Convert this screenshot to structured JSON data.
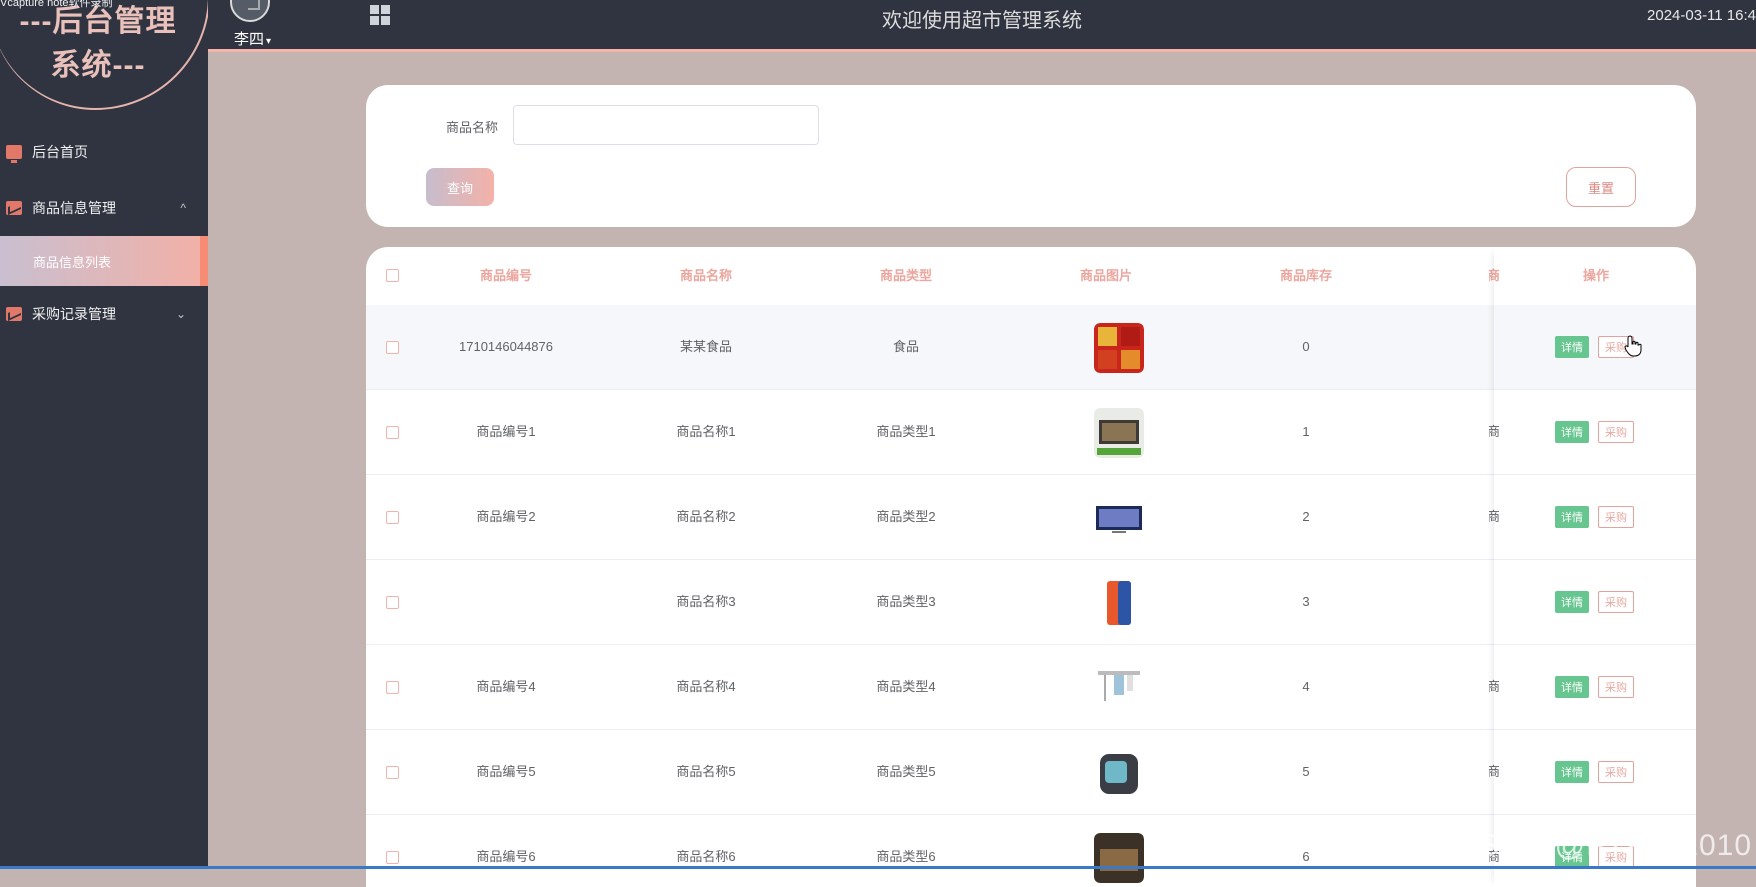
{
  "watermark_top": "Vcapture note软件录制",
  "logo": {
    "line1": "---后台管理",
    "line2": "系统---"
  },
  "sidebar": {
    "items": [
      {
        "label": "后台首页",
        "icon": "monitor-icon"
      },
      {
        "label": "商品信息管理",
        "icon": "chart-icon",
        "arrow": "^"
      },
      {
        "label": "采购记录管理",
        "icon": "chart-icon",
        "arrow": "⌄"
      }
    ],
    "sub_items": [
      {
        "label": "商品信息列表"
      }
    ]
  },
  "header": {
    "username": "李四",
    "caret": "▾",
    "title": "欢迎使用超市管理系统",
    "datetime": "2024-03-11 16:4"
  },
  "search": {
    "label": "商品名称",
    "value": "",
    "query_label": "查询",
    "reset_label": "重置"
  },
  "table": {
    "columns": [
      "商品编号",
      "商品名称",
      "商品类型",
      "商品图片",
      "商品库存",
      "商",
      "操作"
    ],
    "detail_label": "详情",
    "buy_label": "采购",
    "rows": [
      {
        "id": "1710146044876",
        "name": "某某食品",
        "type": "食品",
        "stock": "0",
        "extra": ""
      },
      {
        "id": "商品编号1",
        "name": "商品名称1",
        "type": "商品类型1",
        "stock": "1",
        "extra": "商"
      },
      {
        "id": "商品编号2",
        "name": "商品名称2",
        "type": "商品类型2",
        "stock": "2",
        "extra": "商"
      },
      {
        "id": "",
        "name": "商品名称3",
        "type": "商品类型3",
        "stock": "3",
        "extra": ""
      },
      {
        "id": "商品编号4",
        "name": "商品名称4",
        "type": "商品类型4",
        "stock": "4",
        "extra": "商"
      },
      {
        "id": "商品编号5",
        "name": "商品名称5",
        "type": "商品类型5",
        "stock": "5",
        "extra": "商"
      },
      {
        "id": "商品编号6",
        "name": "商品名称6",
        "type": "商品类型6",
        "stock": "6",
        "extra": "商"
      }
    ]
  },
  "watermark_bottom": "CSDN @FYKJ_2010",
  "colors": {
    "sidebar_bg": "#2f3440",
    "accent": "#f6b3ac",
    "detail_green": "#67c58f",
    "page_bg": "#c3b4b2"
  }
}
